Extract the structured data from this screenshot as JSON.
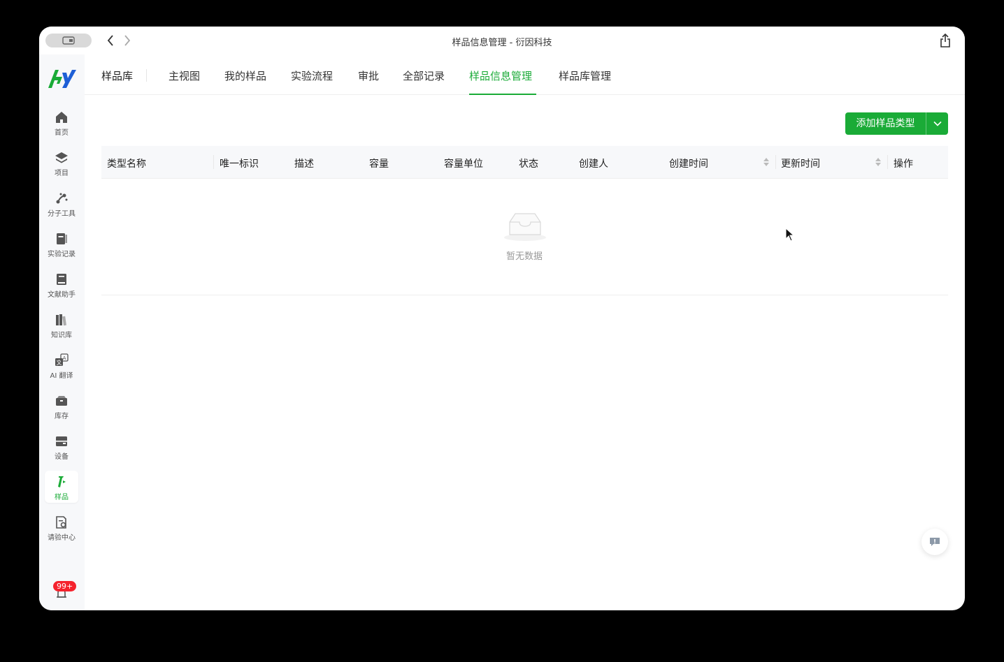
{
  "window": {
    "title": "样品信息管理 - 衍因科技"
  },
  "sidebar": {
    "items": [
      {
        "label": "首页",
        "icon": "home-icon"
      },
      {
        "label": "项目",
        "icon": "layers-icon"
      },
      {
        "label": "分子工具",
        "icon": "molecule-icon"
      },
      {
        "label": "实验记录",
        "icon": "notebook-icon"
      },
      {
        "label": "文献助手",
        "icon": "book-icon"
      },
      {
        "label": "知识库",
        "icon": "library-icon"
      },
      {
        "label": "AI 翻译",
        "icon": "translate-icon"
      },
      {
        "label": "库存",
        "icon": "inventory-icon"
      },
      {
        "label": "设备",
        "icon": "device-icon"
      },
      {
        "label": "样品",
        "icon": "sample-icon",
        "active": true
      },
      {
        "label": "请验中心",
        "icon": "inspection-icon"
      }
    ],
    "notification_badge": "99+"
  },
  "tabs": {
    "home": "样品库",
    "items": [
      {
        "label": "主视图"
      },
      {
        "label": "我的样品"
      },
      {
        "label": "实验流程"
      },
      {
        "label": "审批"
      },
      {
        "label": "全部记录"
      },
      {
        "label": "样品信息管理",
        "active": true
      },
      {
        "label": "样品库管理"
      }
    ]
  },
  "toolbar": {
    "add_label": "添加样品类型"
  },
  "table": {
    "columns": [
      "类型名称",
      "唯一标识",
      "描述",
      "容量",
      "容量单位",
      "状态",
      "创建人",
      "创建时间",
      "更新时间",
      "操作"
    ],
    "empty_text": "暂无数据"
  },
  "colors": {
    "accent": "#1aab37",
    "badge": "#f5222d"
  }
}
